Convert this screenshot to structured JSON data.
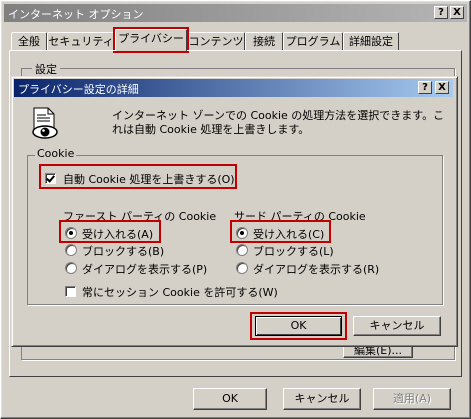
{
  "window": {
    "title": "インターネット オプション",
    "help_btn": "?",
    "close_btn": "X"
  },
  "tabs": [
    {
      "label": "全般"
    },
    {
      "label": "セキュリティ"
    },
    {
      "label": "プライバシー"
    },
    {
      "label": "コンテンツ"
    },
    {
      "label": "接続"
    },
    {
      "label": "プログラム"
    },
    {
      "label": "詳細設定"
    }
  ],
  "selected_tab": "プライバシー",
  "settings_group_label": "設定",
  "bottom_buttons": {
    "ok": "OK",
    "cancel": "キャンセル",
    "apply": "適用(A)"
  },
  "behind_button_label": "編集(E)...",
  "dialog": {
    "title": "プライバシー設定の詳細",
    "help_btn": "?",
    "close_btn": "X",
    "icon": "privacy-eye-document-icon",
    "description": "インターネット ゾーンでの Cookie の処理方法を選択できます。これは自動 Cookie 処理を上書きします。",
    "cookie_group_label": "Cookie",
    "override_checkbox": {
      "label": "自動 Cookie 処理を上書きする(O)",
      "checked": true
    },
    "first_party": {
      "header": "ファースト パーティの Cookie",
      "options": [
        "受け入れる(A)",
        "ブロックする(B)",
        "ダイアログを表示する(P)"
      ],
      "selected": "受け入れる(A)"
    },
    "third_party": {
      "header": "サード パーティの Cookie",
      "options": [
        "受け入れる(C)",
        "ブロックする(L)",
        "ダイアログを表示する(R)"
      ],
      "selected": "受け入れる(C)"
    },
    "session_checkbox": {
      "label": "常にセッション Cookie を許可する(W)",
      "checked": false
    },
    "ok": "OK",
    "cancel": "キャンセル"
  },
  "colors": {
    "face": "#d4d0c8",
    "active_title": "#0a246a",
    "highlight": "#c00000"
  }
}
